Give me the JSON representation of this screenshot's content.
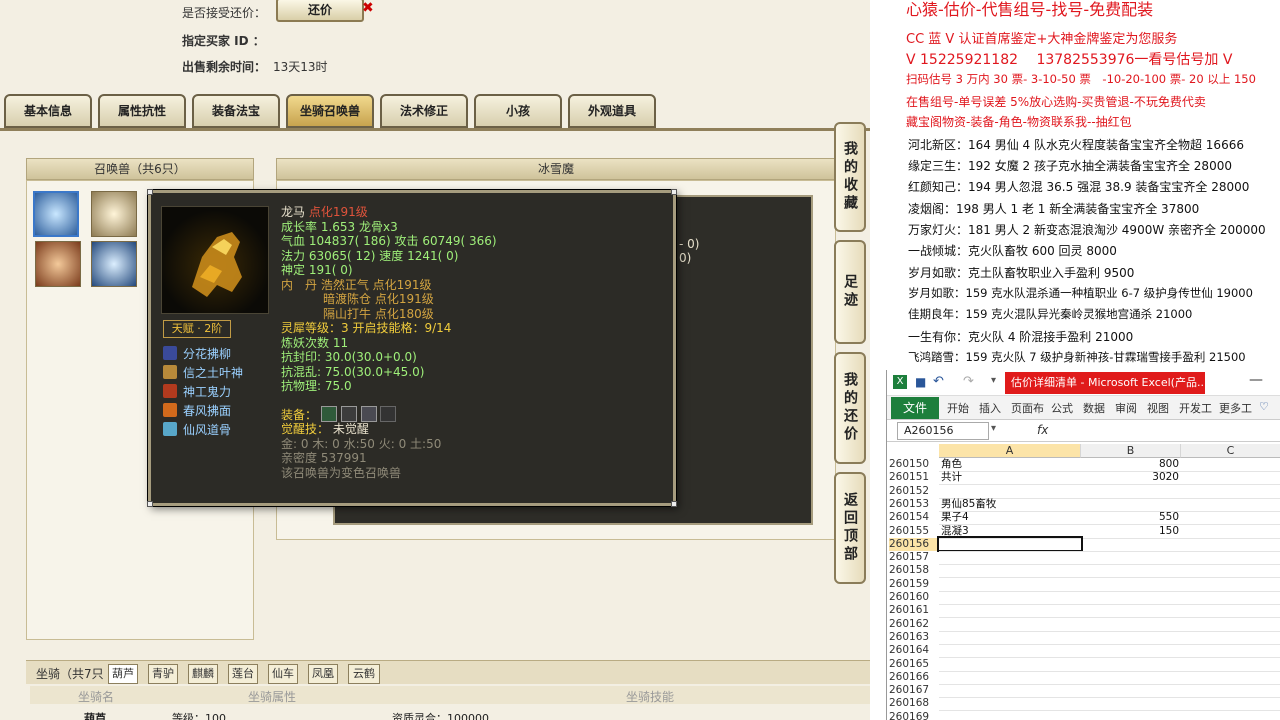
{
  "game": {
    "accept_counter_label": "是否接受还价：",
    "counter_button": "还价",
    "buyer_label": "指定买家 ID ：",
    "time_label": "出售剩余时间：",
    "time_value": "13天13时",
    "tabs": [
      "基本信息",
      "属性抗性",
      "装备法宝",
      "坐骑召唤兽",
      "法术修正",
      "小孩",
      "外观道具"
    ],
    "active_tab": "坐骑召唤兽",
    "summon_panel_title": "召唤兽（共6只）",
    "detail_panel_title": "冰雪魔",
    "side_buttons": [
      "我的收藏",
      "足迹",
      "我的还价",
      "返回顶部"
    ],
    "right_partial": [
      "- 0)",
      "0)"
    ]
  },
  "tooltip": {
    "name": "龙马",
    "name_suffix": "点化191级",
    "growth": "成长率 1.653 龙骨x3",
    "hp": "气血 104837( 186) 攻击 60749( 366)",
    "mp": "法力 63065( 12) 速度 1241( 0)",
    "def": "神定 191( 0)",
    "neidan_1": "内　丹 浩然正气 点化191级",
    "neidan_2": "暗渡陈仓 点化191级",
    "neidan_3": "隔山打牛 点化180级",
    "lingxi": "灵犀等级：3 开启技能格：9/14",
    "lianyao": "炼妖次数 11",
    "res1": "抗封印: 30.0(30.0+0.0)",
    "res2": "抗混乱: 75.0(30.0+45.0)",
    "res3": "抗物理: 75.0",
    "equip_label": "装备：",
    "awaken_label": "觉醒技：",
    "awaken_value": "未觉醒",
    "elements": "金: 0 木: 0 水:50 火: 0 土:50",
    "intimacy": "亲密度 537991",
    "note": "该召唤兽为变色召唤兽",
    "talent": "天赋 · 2阶",
    "skills": [
      "分花拂柳",
      "信之土叶神",
      "神工鬼力",
      "春风拂面",
      "仙风道骨"
    ]
  },
  "mount": {
    "label": "坐骑（共7只",
    "tabs": [
      "葫芦",
      "青驴",
      "麒麟",
      "莲台",
      "仙车",
      "凤凰",
      "云鹤"
    ],
    "columns": [
      "坐骑名",
      "坐骑属性",
      "坐骑技能"
    ],
    "row_name": "葫芦",
    "row_level": "等级：100",
    "row_skill": "资质灵合：100000"
  },
  "ad": {
    "line_top": "心猿-估价-代售组号-找号-免费配装",
    "line_cc": "CC 蓝 V 认证首席鉴定+大神金牌鉴定为您服务",
    "line_v": "V 15225921182　 13782553976一看号估号加 V",
    "line_price": "扫码估号 3 万内 30 票- 3-10-50 票　-10-20-100 票- 20 以上 150",
    "line_sell": "在售组号-单号误差 5%放心选购-买贵管退-不玩免费代卖",
    "line_store": "藏宝阁物资-装备-角色-物资联系我--抽红包",
    "list": [
      "河北新区：164 男仙 4 队水克火程度装备宝宝齐全物超 16666",
      "缘定三生：192 女魔 2 孩子克水抽全满装备宝宝齐全 28000",
      "红颜知己：194 男人忽混 36.5 强混 38.9 装备宝宝齐全 28000",
      "凌烟阁：198 男人 1 老 1 新全满装备宝宝齐全 37800",
      "万家灯火：181 男人 2 新变态混浪淘沙 4900W 亲密齐全 200000",
      "一战倾城：克火队畜牧 600 回灵 8000",
      "岁月如歌：克土队畜牧职业入手盈利 9500",
      "岁月如歌：159 克水队混杀通一种植职业 6-7 级护身传世仙 19000",
      "佳期良年：159 克火混队异光秦岭灵猴地宫通杀 21000",
      "一生有你：克火队 4 阶混接手盈利 21000",
      "飞鸿踏雪：159 克火队 7 级护身新神孩-甘霖瑞雪接手盈利 21500"
    ]
  },
  "excel": {
    "title": "估价详细清单 - Microsoft Excel(产品...",
    "file_tab": "文件",
    "ribbon": [
      "开始",
      "插入",
      "页面布",
      "公式",
      "数据",
      "审阅",
      "视图",
      "开发工",
      "更多工"
    ],
    "name_box": "A260156",
    "fx": "fx",
    "columns": [
      "A",
      "B",
      "C"
    ],
    "rows": [
      {
        "n": "260150",
        "a": "角色",
        "b": "800"
      },
      {
        "n": "260151",
        "a": "共计",
        "b": "3020"
      },
      {
        "n": "260152",
        "a": "",
        "b": ""
      },
      {
        "n": "260153",
        "a": "男仙85畜牧",
        "b": ""
      },
      {
        "n": "260154",
        "a": "果子4",
        "b": "550"
      },
      {
        "n": "260155",
        "a": "混凝3",
        "b": "150"
      },
      {
        "n": "260156",
        "a": "",
        "b": ""
      },
      {
        "n": "260157",
        "a": "",
        "b": ""
      },
      {
        "n": "260158",
        "a": "",
        "b": ""
      },
      {
        "n": "260159",
        "a": "",
        "b": ""
      },
      {
        "n": "260160",
        "a": "",
        "b": ""
      },
      {
        "n": "260161",
        "a": "",
        "b": ""
      },
      {
        "n": "260162",
        "a": "",
        "b": ""
      },
      {
        "n": "260163",
        "a": "",
        "b": ""
      },
      {
        "n": "260164",
        "a": "",
        "b": ""
      },
      {
        "n": "260165",
        "a": "",
        "b": ""
      },
      {
        "n": "260166",
        "a": "",
        "b": ""
      },
      {
        "n": "260167",
        "a": "",
        "b": ""
      },
      {
        "n": "260168",
        "a": "",
        "b": ""
      },
      {
        "n": "260169",
        "a": "",
        "b": ""
      }
    ]
  }
}
